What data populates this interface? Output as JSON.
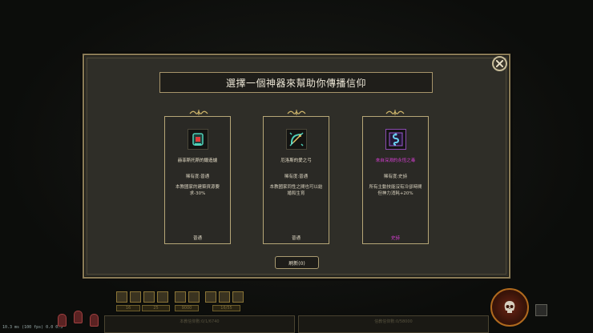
{
  "debug": {
    "text": "10.3 ms (100 fps) 0.0 0.3"
  },
  "dialog": {
    "title": "選擇一個神器來幫助你傳播信仰",
    "refresh_label": "刷新(0)"
  },
  "cards": [
    {
      "name": "赫菲斯托斯的鍛造爐",
      "rarity": "稀有度:普通",
      "desc": "本教國家的建築資源要求-30%",
      "tier": "普通",
      "icon": "forge-icon",
      "color": "#40c0a8"
    },
    {
      "name": "厄洛斯的愛之弓",
      "rarity": "稀有度:普通",
      "desc": "本教國家同性之間也可以結婚和生育",
      "tier": "普通",
      "icon": "bow-icon",
      "color": "#40c0a8"
    },
    {
      "name": "來自深淵的永恆之毒",
      "rarity": "稀有度:史詩",
      "desc": "所有主動技能沒有冷卻時間但神力消耗+20%",
      "tier": "史詩",
      "icon": "poison-icon",
      "color": "#6ad0f0"
    }
  ],
  "hud": {
    "left_bar_text": "本教信仰數:0/1/6740",
    "right_bar_text": "信教信仰數:0/58000",
    "mini_labels": [
      "16",
      "25",
      "9000",
      "16/55"
    ]
  },
  "colors": {
    "epic": "#d43fd0",
    "border": "#b6a677"
  }
}
